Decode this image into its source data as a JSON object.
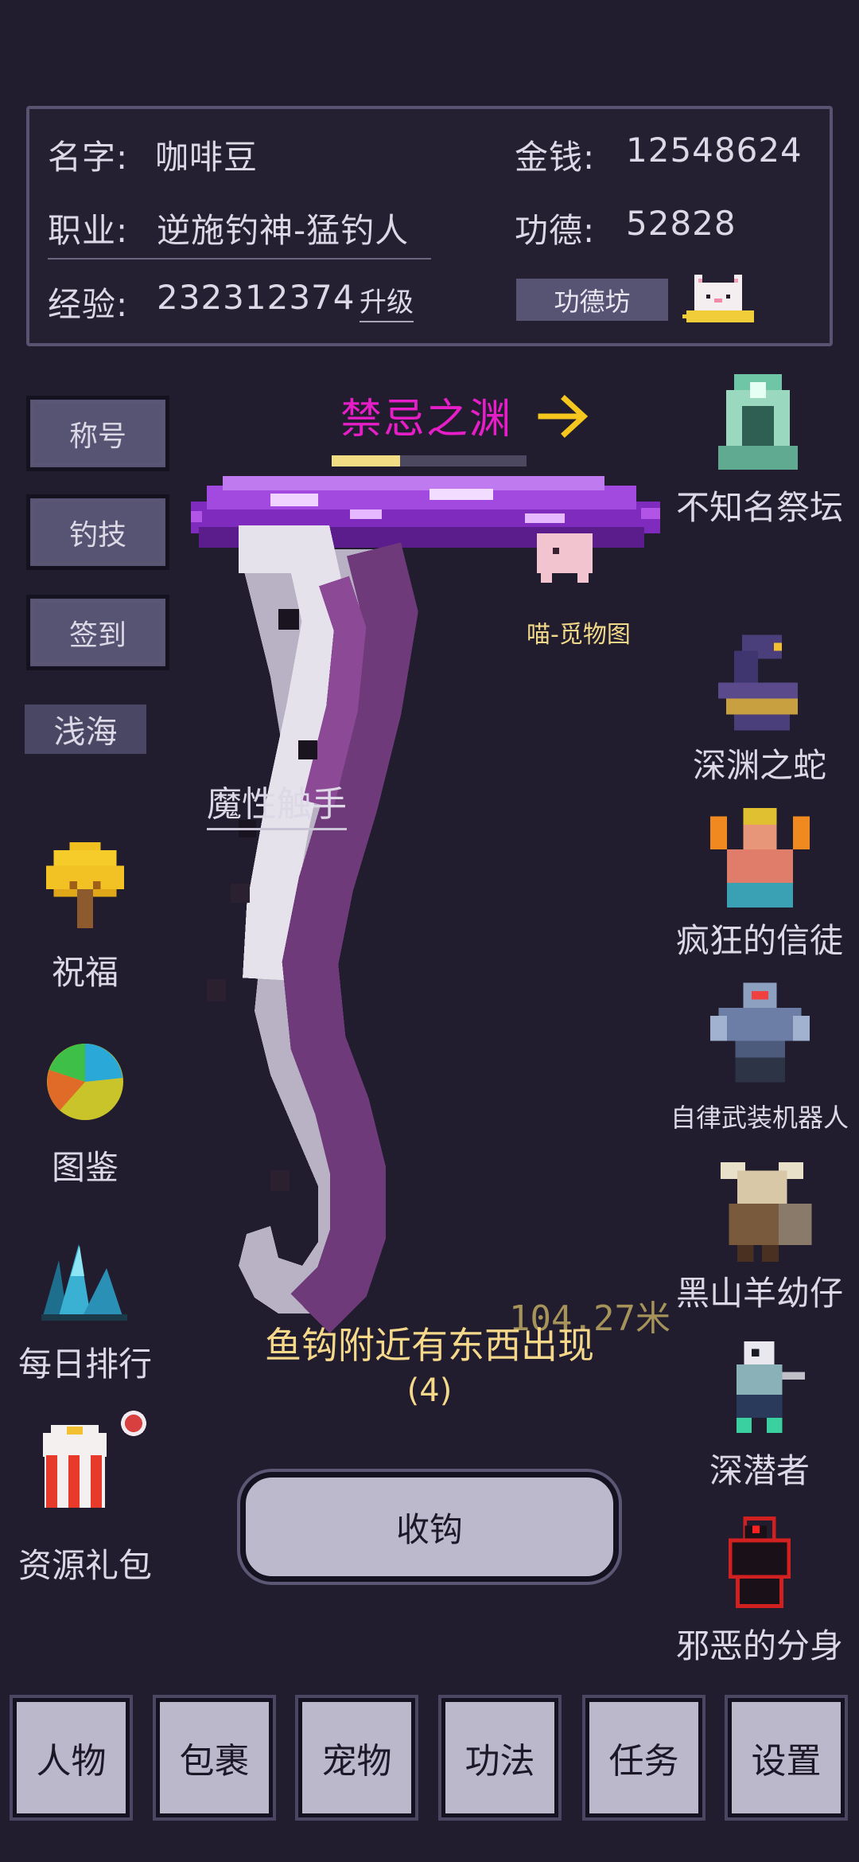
{
  "stats": {
    "name_label": "名字:",
    "name_value": "咖啡豆",
    "job_label": "职业:",
    "job_value": "逆施钓神-猛钓人",
    "exp_label": "经验:",
    "exp_value": "232312374",
    "upgrade_label": "升级",
    "money_label": "金钱:",
    "money_value": "12548624",
    "merit_label": "功德:",
    "merit_value": "52828",
    "merit_shop_label": "功德坊"
  },
  "left_menu": {
    "title_btn": "称号",
    "skill_btn": "钓技",
    "checkin_btn": "签到",
    "zone_tag": "浅海",
    "bless_label": "祝福",
    "codex_label": "图鉴",
    "ranking_label": "每日排行",
    "gift_label": "资源礼包"
  },
  "location": {
    "title": "禁忌之渊",
    "progress": 0.35,
    "arrow_icon": "arrow-right-icon"
  },
  "scene": {
    "pet_label": "喵-觅物图",
    "target_label": "魔性触手",
    "depth": "104.27米",
    "message": "鱼钩附近有东西出现",
    "countdown": "(4)",
    "reel_btn": "收钩"
  },
  "monsters": [
    {
      "label": "不知名祭坛",
      "icon": "altar-icon"
    },
    {
      "label": "深渊之蛇",
      "icon": "serpent-icon"
    },
    {
      "label": "疯狂的信徒",
      "icon": "genie-icon"
    },
    {
      "label": "自律武装机器人",
      "icon": "robot-icon"
    },
    {
      "label": "黑山羊幼仔",
      "icon": "goat-warrior-icon"
    },
    {
      "label": "深潜者",
      "icon": "diver-icon"
    },
    {
      "label": "邪恶的分身",
      "icon": "shadow-clone-icon"
    }
  ],
  "nav": [
    "人物",
    "包裹",
    "宠物",
    "功法",
    "任务",
    "设置"
  ],
  "colors": {
    "background": "#211d2e",
    "accent_magenta": "#e61ec8",
    "accent_gold": "#f5d34a",
    "button": "#575373"
  }
}
